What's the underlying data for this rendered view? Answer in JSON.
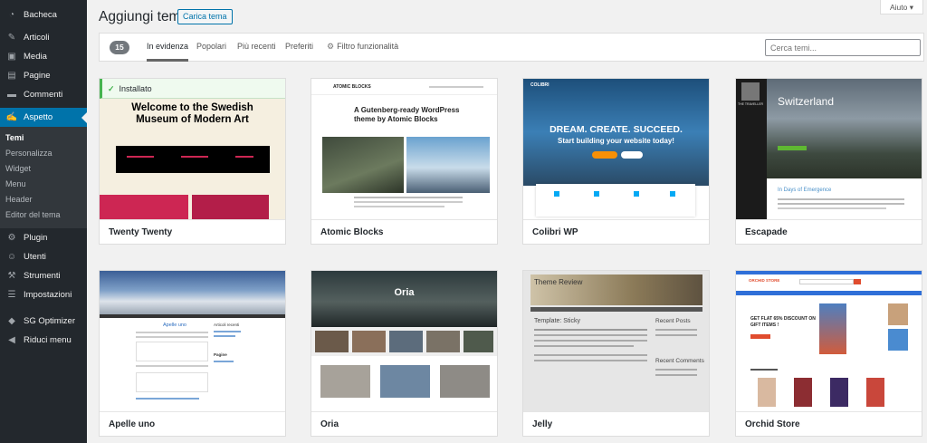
{
  "sidebar": {
    "items": [
      {
        "label": "Bacheca",
        "icon": "dashboard-icon",
        "glyph": "◔"
      },
      {
        "label": "Articoli",
        "icon": "pin-icon",
        "glyph": "✎"
      },
      {
        "label": "Media",
        "icon": "media-icon",
        "glyph": "▣"
      },
      {
        "label": "Pagine",
        "icon": "pages-icon",
        "glyph": "▤"
      },
      {
        "label": "Commenti",
        "icon": "comments-icon",
        "glyph": "▬"
      },
      {
        "label": "Aspetto",
        "icon": "brush-icon",
        "glyph": "✍"
      },
      {
        "label": "Plugin",
        "icon": "plugin-icon",
        "glyph": "⚙"
      },
      {
        "label": "Utenti",
        "icon": "users-icon",
        "glyph": "☺"
      },
      {
        "label": "Strumenti",
        "icon": "tools-icon",
        "glyph": "⚒"
      },
      {
        "label": "Impostazioni",
        "icon": "settings-icon",
        "glyph": "☰"
      },
      {
        "label": "SG Optimizer",
        "icon": "sg-optimizer-icon",
        "glyph": "◆"
      },
      {
        "label": "Riduci menu",
        "icon": "collapse-icon",
        "glyph": "◀"
      }
    ],
    "submenu": [
      "Temi",
      "Personalizza",
      "Widget",
      "Menu",
      "Header",
      "Editor del tema"
    ]
  },
  "header": {
    "title": "Aggiungi temi",
    "upload_label": "Carica tema",
    "help_label": "Aiuto ▾"
  },
  "filter": {
    "count": "15",
    "tabs": [
      "In evidenza",
      "Popolari",
      "Più recenti",
      "Preferiti",
      "Filtro funzionalità"
    ],
    "search_placeholder": "Cerca temi..."
  },
  "themes": [
    {
      "name": "Twenty Twenty",
      "installed": "Installato"
    },
    {
      "name": "Atomic Blocks"
    },
    {
      "name": "Colibri WP"
    },
    {
      "name": "Escapade"
    },
    {
      "name": "Apelle uno"
    },
    {
      "name": "Oria"
    },
    {
      "name": "Jelly"
    },
    {
      "name": "Orchid Store"
    }
  ],
  "previews": {
    "twenty_twenty": {
      "headline_1": "Welcome to the Swedish",
      "headline_2": "Museum of Modern Art"
    },
    "atomic_blocks": {
      "logo": "ATOMIC BLOCKS",
      "headline_1": "A Gutenberg-ready WordPress",
      "headline_2": "theme by Atomic Blocks"
    },
    "colibri": {
      "logo": "COLIBRI",
      "headline": "DREAM. CREATE. SUCCEED.",
      "sub": "Start building your website today!"
    },
    "escapade": {
      "title": "Switzerland",
      "logo": "THE TRAVELLER",
      "subhead": "In Days of Emergence"
    },
    "apelle": {
      "post_title": "Apelle uno",
      "sidebar_title": "Articoli recenti",
      "section": "Pagine"
    },
    "oria": {
      "logo": "Oria"
    },
    "jelly": {
      "header": "Theme Review",
      "post": "Template: Sticky",
      "recent_posts": "Recent Posts",
      "recent_comments": "Recent Comments"
    },
    "orchid": {
      "logo": "ORCHID STORE",
      "promo_1": "GET FLAT 65% DISCOUNT ON",
      "promo_2": "GIFT ITEMS !"
    }
  },
  "colors": {
    "sidebar_bg": "#23282d",
    "accent": "#0073aa",
    "installed": "#46b450"
  }
}
